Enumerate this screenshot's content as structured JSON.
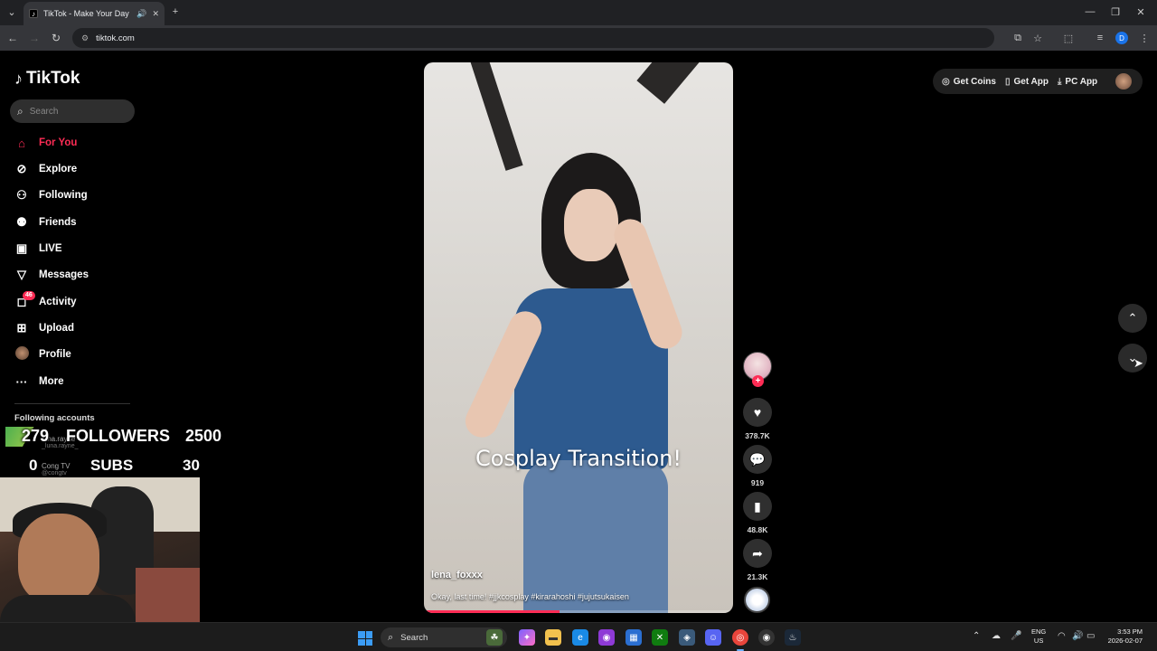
{
  "browser": {
    "tab_title": "TikTok - Make Your Day",
    "url": "tiktok.com",
    "profile_initial": "D"
  },
  "sidebar": {
    "logo": "TikTok",
    "search_placeholder": "Search",
    "items": [
      {
        "label": "For You",
        "icon": "home-icon",
        "active": true
      },
      {
        "label": "Explore",
        "icon": "compass-icon"
      },
      {
        "label": "Following",
        "icon": "following-icon"
      },
      {
        "label": "Friends",
        "icon": "friends-icon"
      },
      {
        "label": "LIVE",
        "icon": "live-icon"
      },
      {
        "label": "Messages",
        "icon": "messages-icon"
      },
      {
        "label": "Activity",
        "icon": "activity-icon",
        "badge": "46"
      },
      {
        "label": "Upload",
        "icon": "upload-icon"
      },
      {
        "label": "Profile",
        "icon": "avatar"
      },
      {
        "label": "More",
        "icon": "more-icon"
      }
    ],
    "following_label": "Following accounts",
    "accounts": [
      {
        "name": "luna.rayne",
        "handle": "_luna.rayne_"
      },
      {
        "name": "Cong TV",
        "handle": "@congtv"
      }
    ]
  },
  "overlay": {
    "followers_count": "279",
    "followers_label": "FOLLOWERS",
    "followers_goal": "2500",
    "subs_count": "0",
    "subs_label": "SUBS",
    "subs_goal": "30"
  },
  "video": {
    "center_text": "Cosplay Transition!",
    "author": "lena_foxxx",
    "caption": "Okay, last time! #jjkcosplay #kirarahoshi #jujutsukaisen",
    "progress": 0.44
  },
  "actions": {
    "likes": "378.7K",
    "comments": "919",
    "saves": "48.8K",
    "shares": "21.3K"
  },
  "topbar": {
    "get_coins": "Get Coins",
    "get_app": "Get App",
    "pc_app": "PC App"
  },
  "taskbar": {
    "search": "Search",
    "lang_top": "ENG",
    "lang_bottom": "US",
    "time": "3:53 PM",
    "date": "2026-02-07"
  }
}
